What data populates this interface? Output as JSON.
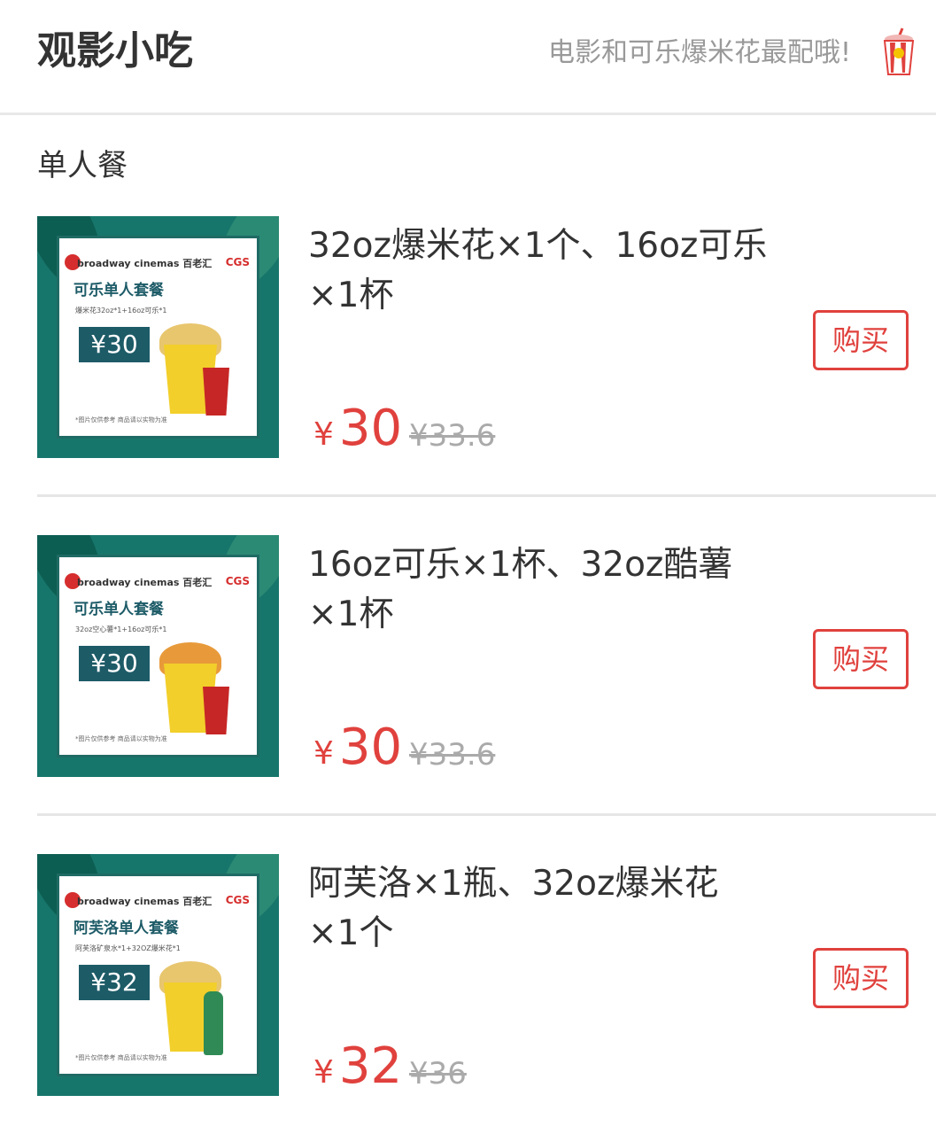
{
  "header": {
    "title": "观影小吃",
    "slogan": "电影和可乐爆米花最配哦!",
    "icon": "popcorn-cup-icon"
  },
  "section": {
    "title": "单人餐"
  },
  "colors": {
    "accent": "#e0413d",
    "thumb_green": "#17766b"
  },
  "items": [
    {
      "description": "32oz爆米花×1个、16oz可乐×1杯",
      "currency": "¥",
      "price": "30",
      "original_price": "¥33.6",
      "buy_label": "购买",
      "thumb": {
        "brand": "broadway cinemas 百老汇",
        "cgs": "CGS",
        "title": "可乐单人套餐",
        "desc": "爆米花32oz*1+16oz可乐*1",
        "price": "¥30",
        "note": "*图片仅供参考 商品请以实物为准",
        "drink": "cola"
      }
    },
    {
      "description": "16oz可乐×1杯、32oz酷薯×1杯",
      "currency": "¥",
      "price": "30",
      "original_price": "¥33.6",
      "buy_label": "购买",
      "thumb": {
        "brand": "broadway cinemas 百老汇",
        "cgs": "CGS",
        "title": "可乐单人套餐",
        "desc": "32oz空心薯*1+16oz可乐*1",
        "price": "¥30",
        "note": "*图片仅供参考 商品请以实物为准",
        "drink": "cola"
      }
    },
    {
      "description": "阿芙洛×1瓶、32oz爆米花×1个",
      "currency": "¥",
      "price": "32",
      "original_price": "¥36",
      "buy_label": "购买",
      "thumb": {
        "brand": "broadway cinemas 百老汇",
        "cgs": "CGS",
        "title": "阿芙洛单人套餐",
        "desc": "阿芙洛矿泉水*1+32OZ爆米花*1",
        "price": "¥32",
        "note": "*图片仅供参考 商品请以实物为准",
        "drink": "bottle"
      }
    }
  ]
}
